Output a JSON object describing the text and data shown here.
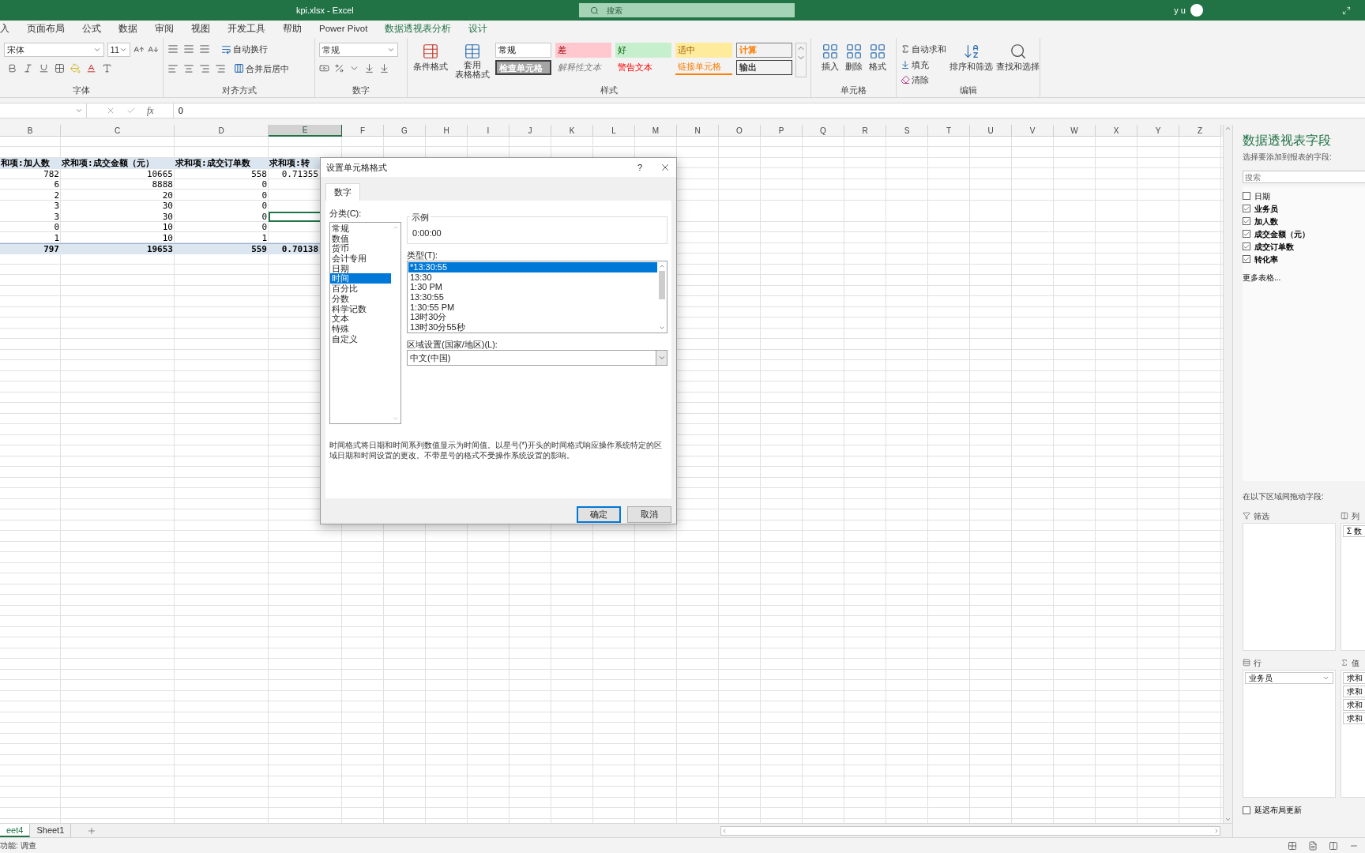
{
  "window": {
    "title": "kpi.xlsx  -  Excel",
    "search_placeholder": "搜索",
    "user": "y u"
  },
  "ribbon_tabs": [
    {
      "label": "入",
      "kind": "normal"
    },
    {
      "label": "页面布局",
      "kind": "normal"
    },
    {
      "label": "公式",
      "kind": "normal"
    },
    {
      "label": "数据",
      "kind": "normal"
    },
    {
      "label": "审阅",
      "kind": "normal"
    },
    {
      "label": "视图",
      "kind": "normal"
    },
    {
      "label": "开发工具",
      "kind": "normal"
    },
    {
      "label": "帮助",
      "kind": "normal"
    },
    {
      "label": "Power Pivot",
      "kind": "normal"
    },
    {
      "label": "数据透视表分析",
      "kind": "contextual"
    },
    {
      "label": "设计",
      "kind": "contextual"
    }
  ],
  "ribbon": {
    "font": {
      "name": "宋体",
      "size": "11",
      "label": "字体"
    },
    "alignment": {
      "wrap": "自动换行",
      "merge": "合并后居中",
      "label": "对齐方式"
    },
    "number": {
      "format": "常规",
      "label": "数字"
    },
    "styles": {
      "conditional": "条件格式",
      "table_format": [
        "套用",
        "表格格式"
      ],
      "label": "样式",
      "gallery": [
        {
          "label": "常规",
          "kind": "normal"
        },
        {
          "label": "差",
          "kind": "bad"
        },
        {
          "label": "好",
          "kind": "good"
        },
        {
          "label": "适中",
          "kind": "neutral"
        },
        {
          "label": "计算",
          "kind": "calculation"
        },
        {
          "label": "检查单元格",
          "kind": "check"
        },
        {
          "label": "解释性文本",
          "kind": "explanatory"
        },
        {
          "label": "警告文本",
          "kind": "warning"
        },
        {
          "label": "链接单元格",
          "kind": "linked"
        },
        {
          "label": "输出",
          "kind": "output"
        }
      ]
    },
    "cells": {
      "buttons": [
        "插入",
        "删除",
        "格式"
      ],
      "label": "单元格"
    },
    "editing": {
      "autosum": "自动求和",
      "fill": "填充",
      "clear": "清除",
      "sort": "排序和筛选",
      "find": "查找和选择",
      "label": "编辑"
    }
  },
  "formula_bar": {
    "function_label": "fx",
    "value": "0"
  },
  "columns": [
    {
      "label": "B",
      "selected": false
    },
    {
      "label": "C",
      "selected": false
    },
    {
      "label": "D",
      "selected": false
    },
    {
      "label": "E",
      "selected": true
    },
    {
      "label": "F",
      "selected": false
    },
    {
      "label": "G",
      "selected": false
    },
    {
      "label": "H",
      "selected": false
    },
    {
      "label": "I",
      "selected": false
    },
    {
      "label": "J",
      "selected": false
    },
    {
      "label": "K",
      "selected": false
    },
    {
      "label": "L",
      "selected": false
    },
    {
      "label": "M",
      "selected": false
    },
    {
      "label": "N",
      "selected": false
    },
    {
      "label": "O",
      "selected": false
    },
    {
      "label": "P",
      "selected": false
    },
    {
      "label": "Q",
      "selected": false
    },
    {
      "label": "R",
      "selected": false
    },
    {
      "label": "S",
      "selected": false
    },
    {
      "label": "T",
      "selected": false
    },
    {
      "label": "U",
      "selected": false
    },
    {
      "label": "V",
      "selected": false
    },
    {
      "label": "W",
      "selected": false
    },
    {
      "label": "X",
      "selected": false
    },
    {
      "label": "Y",
      "selected": false
    },
    {
      "label": "Z",
      "selected": false
    }
  ],
  "pivot": {
    "headers": [
      "和项:加人数",
      "求和项:成交金额（元）",
      "求和项:成交订单数",
      "求和项:转"
    ],
    "rows": [
      {
        "b": "782",
        "c": "10665",
        "d": "558",
        "e": "0.71355",
        "selected": false
      },
      {
        "b": "6",
        "c": "8888",
        "d": "0",
        "selected": false
      },
      {
        "b": "2",
        "c": "20",
        "d": "0",
        "selected": false
      },
      {
        "b": "3",
        "c": "30",
        "d": "0",
        "selected": false
      },
      {
        "b": "3",
        "c": "30",
        "d": "0",
        "selected": true
      },
      {
        "b": "0",
        "c": "10",
        "d": "0",
        "selected": false
      },
      {
        "b": "1",
        "c": "10",
        "d": "1",
        "selected": false
      }
    ],
    "total": {
      "b": "797",
      "c": "19653",
      "d": "559",
      "e": "0.70138"
    }
  },
  "dialog": {
    "title": "设置单元格格式",
    "help": "?",
    "tabs": [
      {
        "label": "数字",
        "selected": true
      }
    ],
    "category_label": "分类(C):",
    "categories": [
      {
        "label": "常规",
        "selected": false
      },
      {
        "label": "数值",
        "selected": false
      },
      {
        "label": "货币",
        "selected": false
      },
      {
        "label": "会计专用",
        "selected": false
      },
      {
        "label": "日期",
        "selected": false
      },
      {
        "label": "时间",
        "selected": true
      },
      {
        "label": "百分比",
        "selected": false
      },
      {
        "label": "分数",
        "selected": false
      },
      {
        "label": "科学记数",
        "selected": false
      },
      {
        "label": "文本",
        "selected": false
      },
      {
        "label": "特殊",
        "selected": false
      },
      {
        "label": "自定义",
        "selected": false
      }
    ],
    "sample_label": "示例",
    "sample_value": "0:00:00",
    "type_label": "类型(T):",
    "types": [
      {
        "label": "*13:30:55",
        "selected": true
      },
      {
        "label": "13:30",
        "selected": false
      },
      {
        "label": "1:30 PM",
        "selected": false
      },
      {
        "label": "13:30:55",
        "selected": false
      },
      {
        "label": "1:30:55 PM",
        "selected": false
      },
      {
        "label": "13时30分",
        "selected": false
      },
      {
        "label": "13时30分55秒",
        "selected": false
      }
    ],
    "locale_label": "区域设置(国家/地区)(L):",
    "locale": "中文(中国)",
    "description": "时间格式将日期和时间系列数值显示为时间值。以星号(*)开头的时间格式响应操作系统特定的区域日期和时间设置的更改。不带星号的格式不受操作系统设置的影响。",
    "buttons": [
      {
        "label": "确定",
        "kind": "default"
      },
      {
        "label": "取消",
        "kind": "normal"
      }
    ]
  },
  "field_pane": {
    "title": "数据透视表字段",
    "subtitle": "选择要添加到报表的字段:",
    "search_placeholder": "搜索",
    "fields": [
      {
        "label": "日期",
        "checked": false
      },
      {
        "label": "业务员",
        "checked": true
      },
      {
        "label": "加人数",
        "checked": true
      },
      {
        "label": "成交金额（元）",
        "checked": true
      },
      {
        "label": "成交订单数",
        "checked": true
      },
      {
        "label": "转化率",
        "checked": true
      }
    ],
    "more_tables": "更多表格...",
    "drag_hint": "在以下区域间拖动字段:",
    "areas": [
      {
        "kind": "filter",
        "label": "筛选"
      },
      {
        "kind": "columns",
        "label": "列",
        "items": [
          "Σ 数"
        ]
      },
      {
        "kind": "rows",
        "label": "行",
        "items": [
          "业务员"
        ]
      },
      {
        "kind": "values",
        "label": "值",
        "items": [
          "求和",
          "求和",
          "求和",
          "求和"
        ]
      }
    ],
    "defer_update": {
      "label": "延迟布局更新",
      "checked": false
    }
  },
  "sheet_tabs": [
    {
      "label": "eet4",
      "selected": true
    },
    {
      "label": "Sheet1",
      "selected": false
    }
  ],
  "status_bar": {
    "text": "功能: 调查"
  }
}
